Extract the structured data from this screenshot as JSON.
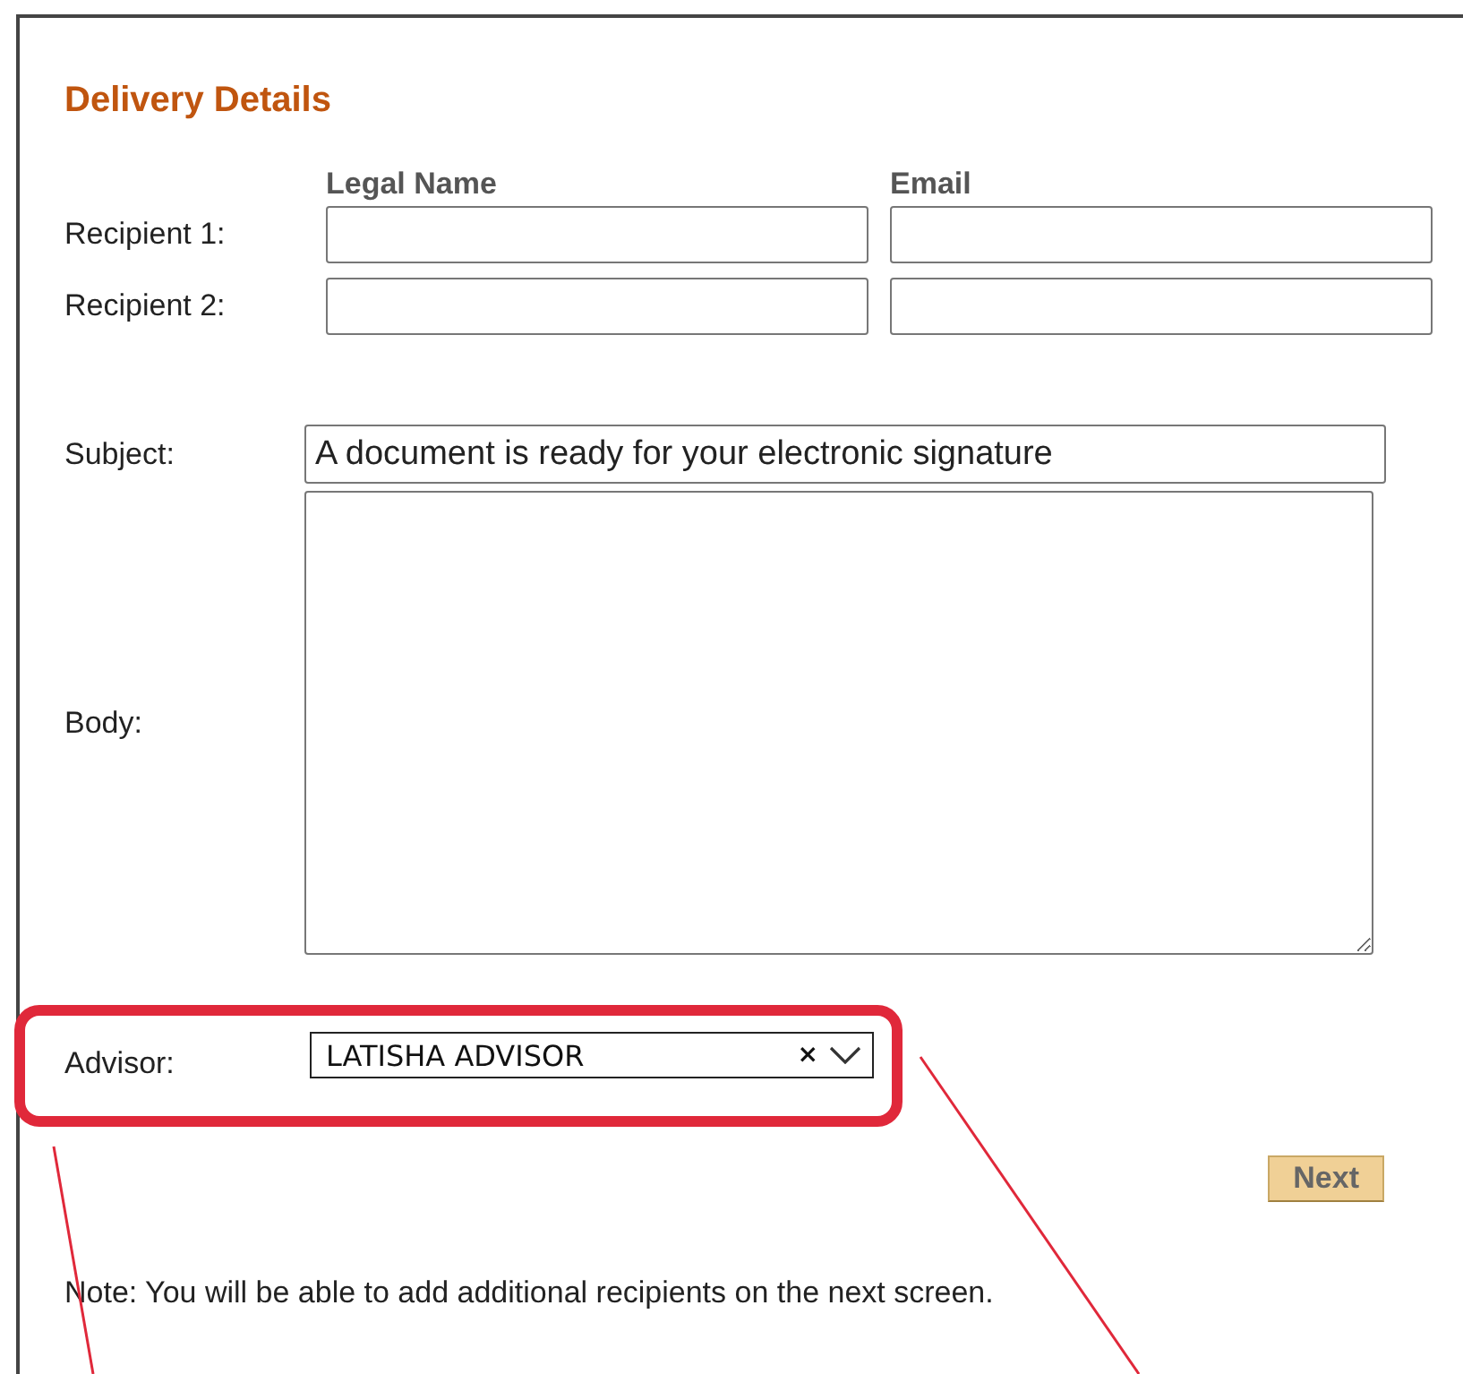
{
  "panel": {
    "title": "Delivery Details",
    "columns": [
      "Legal Name",
      "Email"
    ],
    "recipients": [
      {
        "label": "Recipient 1:"
      },
      {
        "label": "Recipient 2:"
      }
    ],
    "subject": {
      "label": "Subject:",
      "value": "A document is ready for your electronic signature"
    },
    "body": {
      "label": "Body:"
    },
    "advisor": {
      "label": "Advisor:",
      "value": "LATISHA ADVISOR",
      "clear": "×"
    },
    "next_button": "Next",
    "note": "Note: You will be able to add additional recipients on the next screen."
  }
}
